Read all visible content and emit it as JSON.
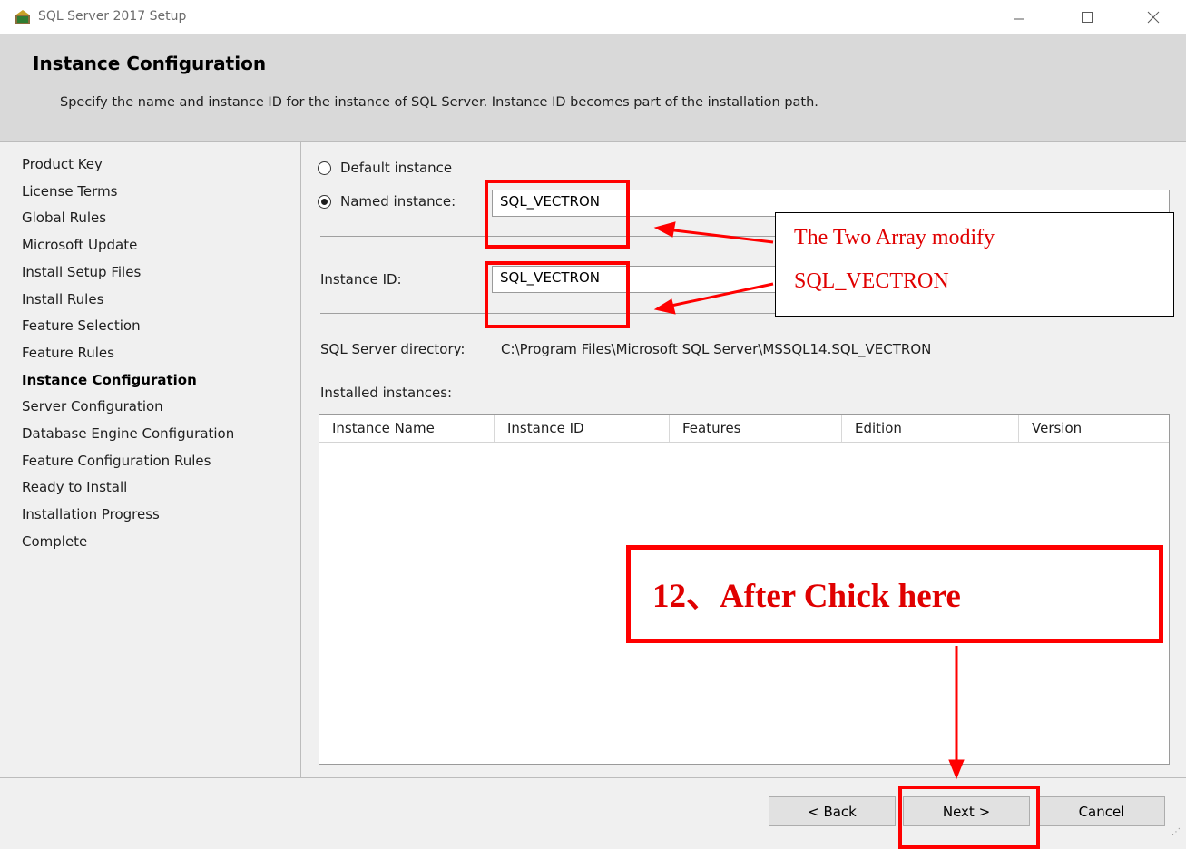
{
  "window": {
    "title": "SQL Server 2017 Setup",
    "controls": {
      "minimize": "—",
      "maximize": "☐",
      "close": "✕"
    }
  },
  "header": {
    "title": "Instance Configuration",
    "description": "Specify the name and instance ID for the instance of SQL Server. Instance ID becomes part of the installation path."
  },
  "sidebar": {
    "items": [
      {
        "label": "Product Key"
      },
      {
        "label": "License Terms"
      },
      {
        "label": "Global Rules"
      },
      {
        "label": "Microsoft Update"
      },
      {
        "label": "Install Setup Files"
      },
      {
        "label": "Install Rules"
      },
      {
        "label": "Feature Selection"
      },
      {
        "label": "Feature Rules"
      },
      {
        "label": "Instance Configuration",
        "active": true
      },
      {
        "label": "Server Configuration"
      },
      {
        "label": "Database Engine Configuration"
      },
      {
        "label": "Feature Configuration Rules"
      },
      {
        "label": "Ready to Install"
      },
      {
        "label": "Installation Progress"
      },
      {
        "label": "Complete"
      }
    ]
  },
  "form": {
    "default_instance_label": "Default instance",
    "named_instance_label": "Named instance:",
    "named_instance_value": "SQL_VECTRON",
    "instance_id_label": "Instance ID:",
    "instance_id_value": "SQL_VECTRON",
    "directory_label": "SQL Server directory:",
    "directory_value": "C:\\Program Files\\Microsoft SQL Server\\MSSQL14.SQL_VECTRON",
    "installed_label": "Installed instances:"
  },
  "table": {
    "columns": [
      "Instance Name",
      "Instance ID",
      "Features",
      "Edition",
      "Version"
    ],
    "rows": []
  },
  "footer": {
    "back": "< Back",
    "next": "Next >",
    "cancel": "Cancel"
  },
  "annotations": {
    "note_line1": "The Two Array modify",
    "note_line2": "SQL_VECTRON",
    "step_text": "12、After Chick here",
    "color": "#ff0000"
  }
}
